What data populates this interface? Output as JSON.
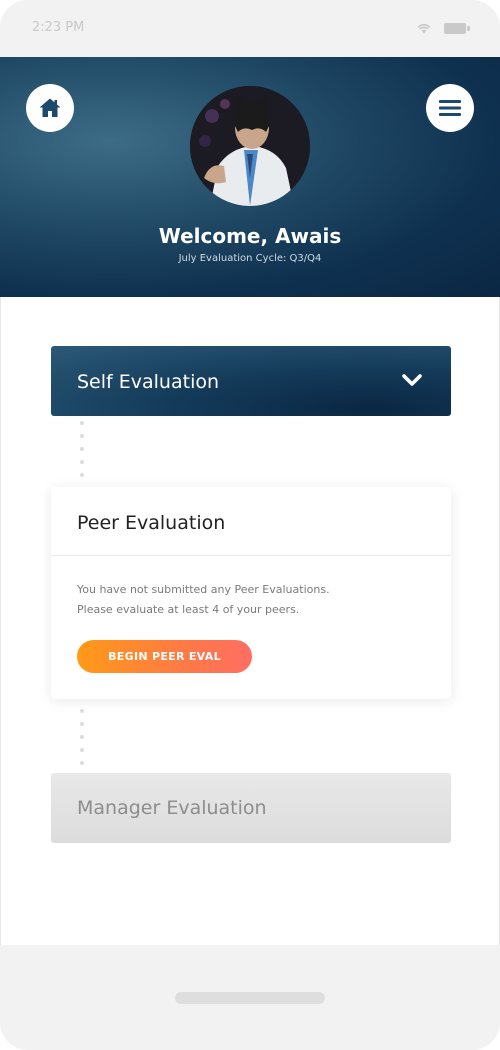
{
  "status_bar": {
    "time": "2:23 PM",
    "icons": [
      "wifi-icon",
      "battery-icon"
    ]
  },
  "header": {
    "welcome": "Welcome, Awais",
    "cycle": "July Evaluation Cycle: Q3/Q4",
    "home_icon": "home-icon",
    "menu_icon": "hamburger-menu-icon",
    "gradient_colors": [
      "#3d6c87",
      "#0a2743"
    ]
  },
  "sections": {
    "self_eval": {
      "label": "Self Evaluation",
      "icon": "chevron-down-icon"
    },
    "peer_eval": {
      "title": "Peer Evaluation",
      "message_line1": "You have not submitted any Peer Evaluations.",
      "message_line2": "Please evaluate at least 4 of your peers.",
      "button_label": "BEGIN PEER EVAL"
    },
    "manager_eval": {
      "label": "Manager Evaluation"
    }
  },
  "colors": {
    "accent_orange": "#ff9a17",
    "accent_pink": "#ff6e63",
    "navy": "#0a2743"
  }
}
